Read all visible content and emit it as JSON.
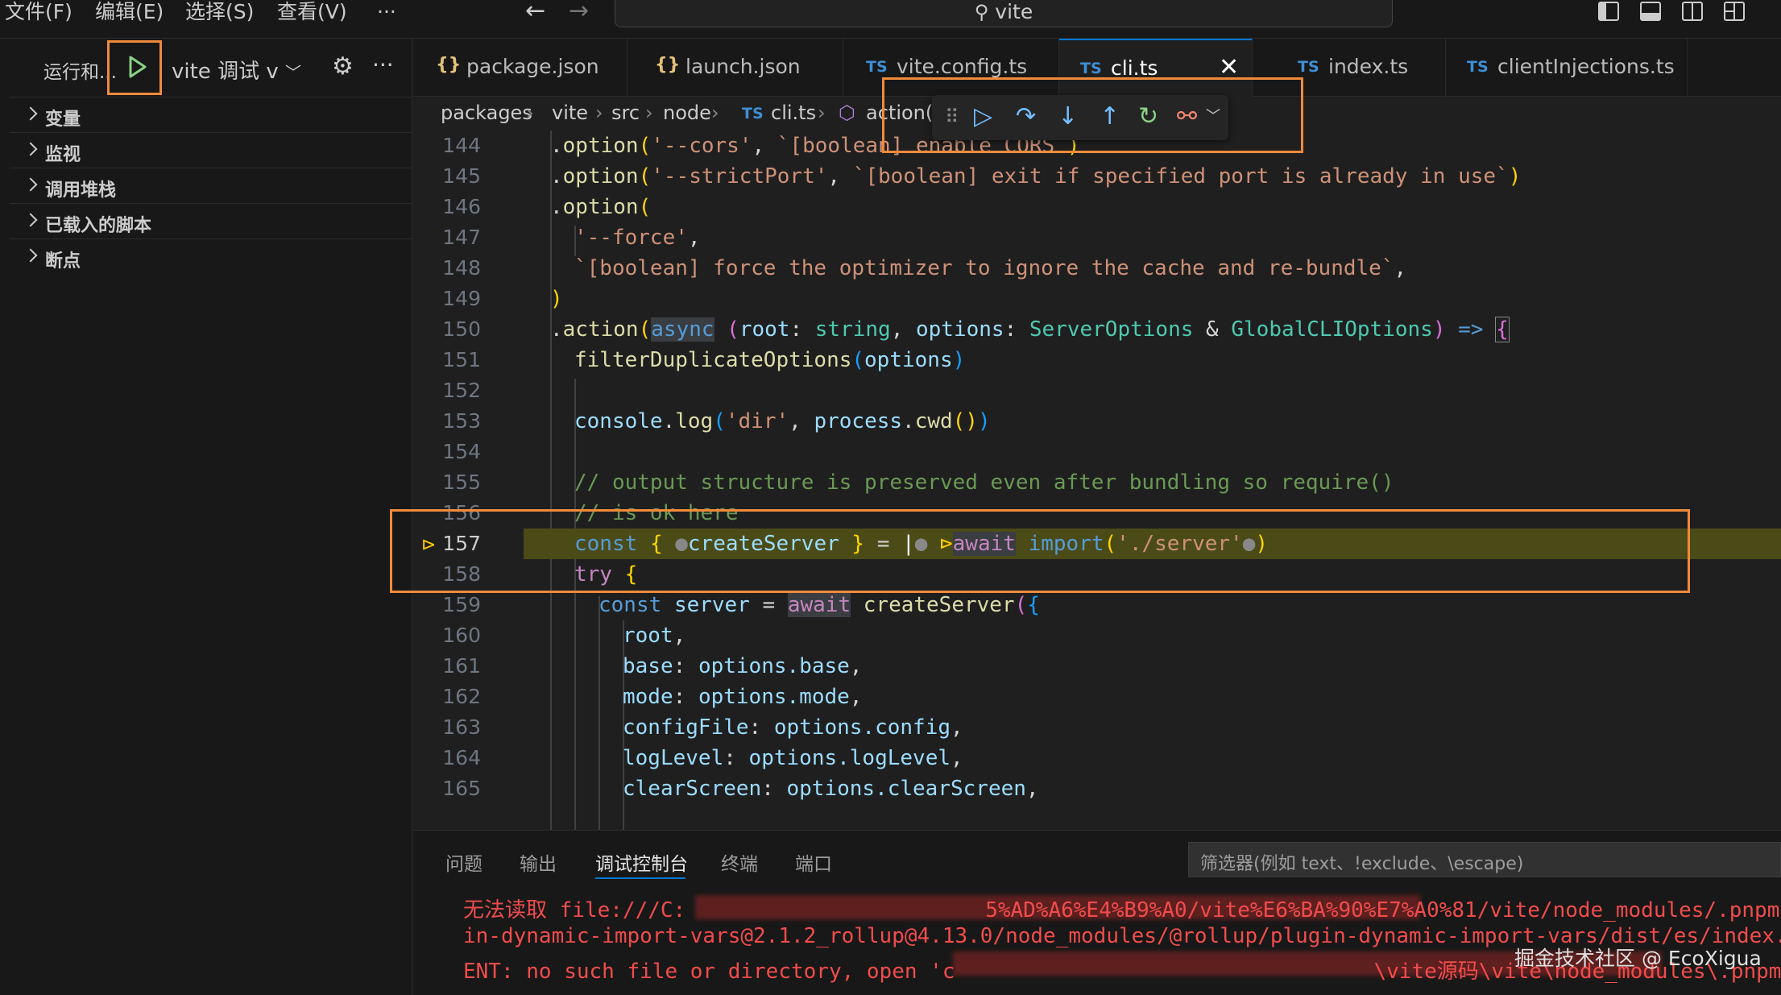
{
  "menu": {
    "file": "文件(F)",
    "edit": "编辑(E)",
    "select": "选择(S)",
    "view": "查看(V)",
    "more": "···"
  },
  "command_center": {
    "label": "vite"
  },
  "sidebar": {
    "run_label": "运行和...",
    "config_name": "vite 调试 v",
    "sections": [
      "变量",
      "监视",
      "调用堆栈",
      "已载入的脚本",
      "断点"
    ]
  },
  "tabs": [
    {
      "type": "{}",
      "name": "package.json"
    },
    {
      "type": "{}",
      "name": "launch.json"
    },
    {
      "type": "TS",
      "name": "vite.config.ts"
    },
    {
      "type": "TS",
      "name": "cli.ts"
    },
    {
      "type": "TS",
      "name": "index.ts"
    },
    {
      "type": "TS",
      "name": "clientInjections.ts"
    }
  ],
  "breadcrumb": {
    "items": [
      "packages",
      "vite",
      "src",
      "node"
    ],
    "file_type": "TS",
    "file": "cli.ts",
    "symbol": "action("
  },
  "editor": {
    "line_numbers": [
      "144",
      "145",
      "146",
      "147",
      "148",
      "149",
      "150",
      "151",
      "152",
      "153",
      "154",
      "155",
      "156",
      "157",
      "158",
      "159",
      "160",
      "161",
      "162",
      "163",
      "164",
      "165"
    ],
    "current_line": "157",
    "l144_str1": "'--cors'",
    "l144_str2": "`[boolean] enable CORS`",
    "l145_str1": "'--strictPort'",
    "l145_str2": "`[boolean] exit if specified port is already in use`",
    "l147_str": "'--force'",
    "l148_str": "`[boolean] force the optimizer to ignore the cache and re-bundle`",
    "l150_async": "async",
    "l150_root": "root",
    "l150_string": "string",
    "l150_options": "options",
    "l150_type1": "ServerOptions",
    "l150_type2": "GlobalCLIOptions",
    "l151_fn": "filterDuplicateOptions",
    "l151_arg": "options",
    "l153_obj": "console",
    "l153_fn": "log",
    "l153_str": "'dir'",
    "l153_obj2": "process",
    "l153_fn2": "cwd",
    "l155_comment": "// output structure is preserved even after bundling so require()",
    "l156_comment": "// is ok here",
    "l157_const": "const",
    "l157_name": "createServer",
    "l157_await": "await",
    "l157_import": "import",
    "l157_str": "'./server'",
    "l158_try": "try",
    "l159_const": "const",
    "l159_name": "server",
    "l159_await": "await",
    "l159_fn": "createServer",
    "l160_prop": "root",
    "l161_prop": "base",
    "l161_val": "options.base",
    "l162_prop": "mode",
    "l162_val": "options.mode",
    "l163_prop": "configFile",
    "l163_val": "options.config",
    "l164_prop": "logLevel",
    "l164_val": "options.logLevel",
    "l165_prop": "clearScreen",
    "l165_val": "options.clearScreen"
  },
  "panel": {
    "tabs": [
      "问题",
      "输出",
      "调试控制台",
      "终端",
      "端口"
    ],
    "active_tab": "调试控制台",
    "filter_placeholder": "筛选器(例如 text、!exclude、\\escape)",
    "output": {
      "line1_a": "无法读取 file:///C:",
      "line1_b": "5%AD%A6%E4%B9%A0/vite%E6%BA%90%E7%A0%81/vite/node_modules/.pnpm",
      "line2": "in-dynamic-import-vars@2.1.2_rollup@4.13.0/node_modules/@rollup/plugin-dynamic-import-vars/dist/es/index.js",
      "line3_a": "ENT: no such file or directory, open 'c",
      "line3_b": "\\vite源码\\vite\\node_modules\\.pnpm\\@roll"
    }
  },
  "watermark": "掘金技术社区 @ EcoXigua",
  "colors": {
    "accent_orange": "#f08a3a",
    "debug_green": "#89d185",
    "debug_blue": "#75beff",
    "breakpoint_yellow": "#ffcc00",
    "error_red": "#f14c4c"
  }
}
